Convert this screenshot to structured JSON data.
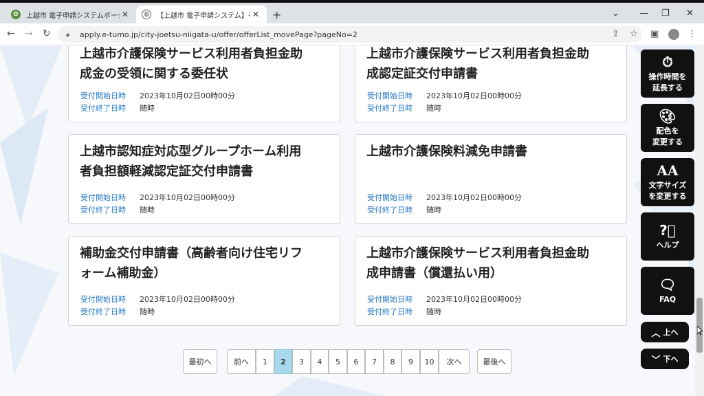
{
  "browser": {
    "tabs": [
      {
        "title": "上越市 電子申請システムポータルサイ",
        "favicon": "city-logo-icon"
      },
      {
        "title": "【上越市 電子申請システム】手続き",
        "favicon": "globe-icon"
      }
    ],
    "url": "apply.e-tumo.jp/city-joetsu-niigata-u/offer/offerList_movePage?pageNo=2"
  },
  "cards": [
    {
      "title_line1": "上越市介護保険サービス利用者負担金助",
      "title_line2": "成金の受領に関する委任状",
      "start_label": "受付開始日時",
      "start_value": "2023年10月02日00時00分",
      "end_label": "受付終了日時",
      "end_value": "随時"
    },
    {
      "title_line1": "上越市介護保険サービス利用者負担金助",
      "title_line2": "成認定証交付申請書",
      "start_label": "受付開始日時",
      "start_value": "2023年10月02日00時00分",
      "end_label": "受付終了日時",
      "end_value": "随時"
    },
    {
      "title_line1": "上越市認知症対応型グループホーム利用",
      "title_line2": "者負担額軽減認定証交付申請書",
      "start_label": "受付開始日時",
      "start_value": "2023年10月02日00時00分",
      "end_label": "受付終了日時",
      "end_value": "随時"
    },
    {
      "title_line1": "上越市介護保険料減免申請書",
      "title_line2": "",
      "start_label": "受付開始日時",
      "start_value": "2023年10月02日00時00分",
      "end_label": "受付終了日時",
      "end_value": "随時"
    },
    {
      "title_line1": "補助金交付申請書（高齢者向け住宅リフ",
      "title_line2": "ォーム補助金）",
      "start_label": "受付開始日時",
      "start_value": "2023年10月02日00時00分",
      "end_label": "受付終了日時",
      "end_value": "随時"
    },
    {
      "title_line1": "上越市介護保険サービス利用者負担金助",
      "title_line2": "成申請書（償還払い用）",
      "start_label": "受付開始日時",
      "start_value": "2023年10月02日00時00分",
      "end_label": "受付終了日時",
      "end_value": "随時"
    }
  ],
  "pagination": {
    "first": "最初へ",
    "prev": "前へ",
    "pages": [
      "1",
      "2",
      "3",
      "4",
      "5",
      "6",
      "7",
      "8",
      "9",
      "10"
    ],
    "current": "2",
    "next": "次へ",
    "last": "最後へ"
  },
  "sidebar": {
    "extend_line1": "操作時間を",
    "extend_line2": "延長する",
    "color_line1": "配色を",
    "color_line2": "変更する",
    "textsize_line1": "文字サイズ",
    "textsize_line2": "を変更する",
    "help": "ヘルプ",
    "faq": "FAQ",
    "up": "上へ",
    "down": "下へ"
  },
  "colors": {
    "accent_label": "#2a7cc7",
    "current_page": "#a8d8ee",
    "sidebar_bg": "#111111"
  }
}
